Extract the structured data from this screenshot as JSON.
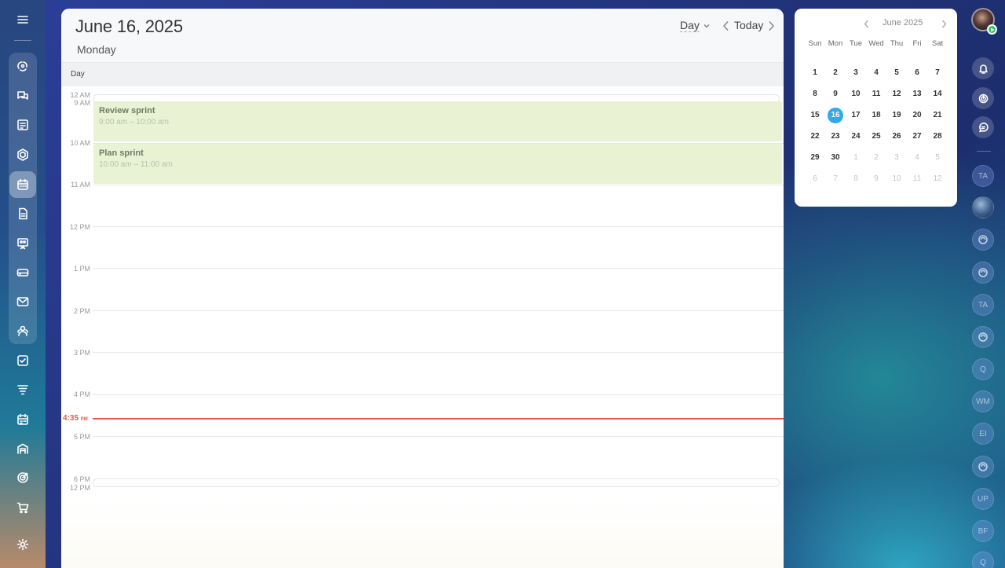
{
  "header": {
    "date": "June 16, 2025",
    "weekday": "Monday",
    "view_mode": "Day",
    "today_label": "Today"
  },
  "day_bar_label": "Day",
  "timeline": {
    "top_collapsed": [
      "12 AM",
      "9 AM"
    ],
    "hours": [
      "10 AM",
      "11 AM",
      "12 PM",
      "1 PM",
      "2 PM",
      "3 PM",
      "4 PM",
      "5 PM"
    ],
    "bottom_collapsed": [
      "6 PM",
      "12 PM"
    ],
    "now_time": "4:35",
    "now_suffix": "PM"
  },
  "events": [
    {
      "title": "Review sprint",
      "time": "9:00 am – 10:00 am"
    },
    {
      "title": "Plan sprint",
      "time": "10:00 am – 11:00 am"
    }
  ],
  "mini_calendar": {
    "month": "June 2025",
    "weekdays": [
      "Sun",
      "Mon",
      "Tue",
      "Wed",
      "Thu",
      "Fri",
      "Sat"
    ],
    "days": [
      [
        "1",
        "2",
        "3",
        "4",
        "5",
        "6",
        "7"
      ],
      [
        "8",
        "9",
        "10",
        "11",
        "12",
        "13",
        "14"
      ],
      [
        "15",
        "16",
        "17",
        "18",
        "19",
        "20",
        "21"
      ],
      [
        "22",
        "23",
        "24",
        "25",
        "26",
        "27",
        "28"
      ],
      [
        "29",
        "30",
        "1",
        "2",
        "3",
        "4",
        "5"
      ],
      [
        "6",
        "7",
        "8",
        "9",
        "10",
        "11",
        "12"
      ]
    ],
    "selected": "16"
  },
  "right_rail": {
    "avatars": [
      "TA",
      "",
      "",
      "",
      "TA",
      "",
      "Q",
      "WM",
      "EI",
      "",
      "UP",
      "BF",
      "Q"
    ]
  },
  "colors": {
    "accent": "#2fa9e8",
    "event_bg": "#e9f3d3",
    "now_line": "#e55a4e",
    "status_online": "#2dc26b"
  }
}
